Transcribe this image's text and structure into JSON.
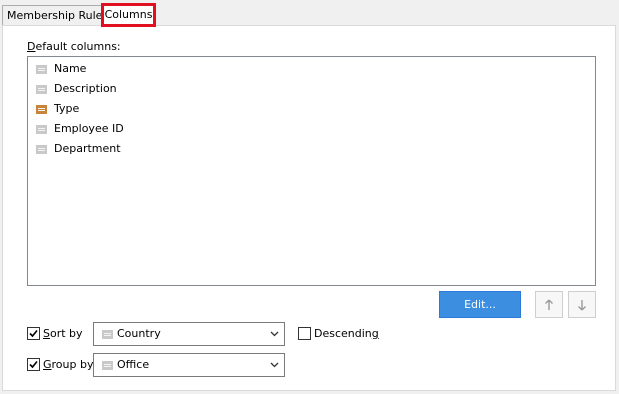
{
  "tabs": [
    {
      "label": "Membership Rules"
    },
    {
      "label": "Columns"
    }
  ],
  "columns_panel": {
    "default_columns_label": "Default columns:",
    "items": [
      {
        "label": "Name",
        "icon": "column-icon"
      },
      {
        "label": "Description",
        "icon": "column-icon"
      },
      {
        "label": "Type",
        "icon": "column-icon-highlighted",
        "icon_color": "#c8843a"
      },
      {
        "label": "Employee ID",
        "icon": "column-icon"
      },
      {
        "label": "Department",
        "icon": "column-icon"
      }
    ],
    "edit_label": "Edit...",
    "sort_by": {
      "checked": true,
      "label": "Sort by",
      "value": "Country"
    },
    "descending": {
      "checked": false,
      "label": "Descending"
    },
    "group_by": {
      "checked": true,
      "label": "Group by",
      "value": "Office"
    }
  },
  "colors": {
    "accent": "#3b8ee0",
    "highlight_border": "#e01020"
  }
}
